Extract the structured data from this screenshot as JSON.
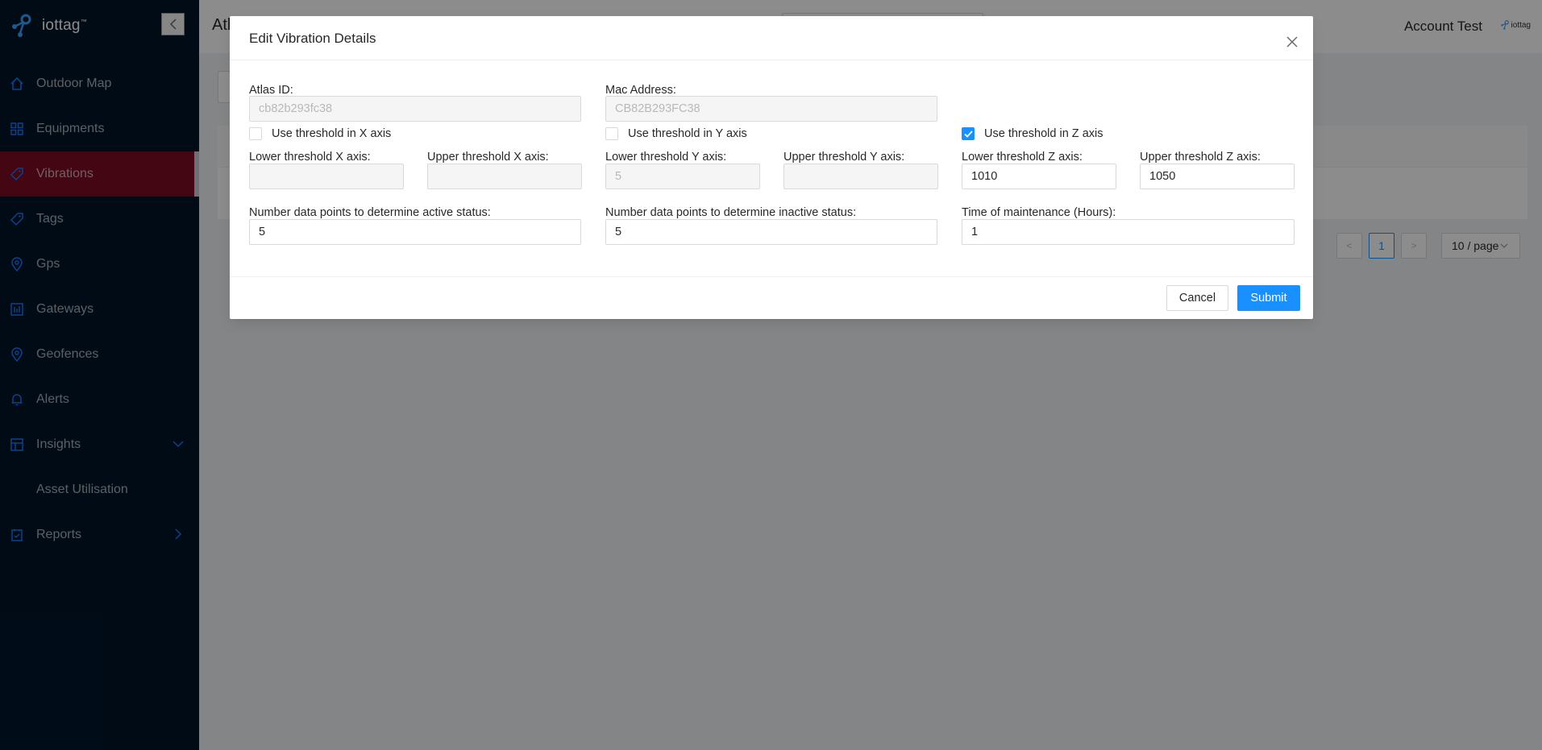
{
  "app": {
    "brand": "iottag",
    "brand_mark": "™",
    "small_brand": "iottag",
    "page_title": "Atl",
    "account_name": "Account Test"
  },
  "sidebar": {
    "items": [
      {
        "label": "Outdoor Map",
        "icon": "home-icon"
      },
      {
        "label": "Equipments",
        "icon": "grid-icon"
      },
      {
        "label": "Vibrations",
        "icon": "tag-icon",
        "active": true
      },
      {
        "label": "Tags",
        "icon": "tag-icon"
      },
      {
        "label": "Gps",
        "icon": "location-icon"
      },
      {
        "label": "Gateways",
        "icon": "gateway-icon"
      },
      {
        "label": "Geofences",
        "icon": "location-icon"
      },
      {
        "label": "Alerts",
        "icon": "bell-icon"
      },
      {
        "label": "Insights",
        "icon": "insights-icon",
        "expandable": "down"
      },
      {
        "label": "Asset Utilisation",
        "sub": true
      },
      {
        "label": "Reports",
        "icon": "report-icon",
        "expandable": "right"
      }
    ]
  },
  "pagination": {
    "current_page": "1",
    "prev": "<",
    "next": ">",
    "page_size": "10 / page"
  },
  "modal": {
    "title": "Edit Vibration Details",
    "atlas_id": {
      "label": "Atlas ID:",
      "value": "cb82b293fc38"
    },
    "mac_address": {
      "label": "Mac Address:",
      "value": "CB82B293FC38"
    },
    "x_axis": {
      "use_label": "Use threshold in X axis",
      "checked": false,
      "lower_label": "Lower threshold X axis:",
      "lower_value": "",
      "upper_label": "Upper threshold X axis:",
      "upper_value": ""
    },
    "y_axis": {
      "use_label": "Use threshold in Y axis",
      "checked": false,
      "lower_label": "Lower threshold Y axis:",
      "lower_value": "5",
      "upper_label": "Upper threshold Y axis:",
      "upper_value": ""
    },
    "z_axis": {
      "use_label": "Use threshold in Z axis",
      "checked": true,
      "lower_label": "Lower threshold Z axis:",
      "lower_value": "1010",
      "upper_label": "Upper threshold Z axis:",
      "upper_value": "1050"
    },
    "active_points": {
      "label": "Number data points to determine active status:",
      "value": "5"
    },
    "inactive_points": {
      "label": "Number data points to determine inactive status:",
      "value": "5"
    },
    "maintenance": {
      "label": "Time of maintenance (Hours):",
      "value": "1"
    },
    "cancel_label": "Cancel",
    "submit_label": "Submit"
  },
  "colors": {
    "sidebar_bg": "#001529",
    "active_item_bg": "#7a0b22",
    "primary": "#1890ff"
  }
}
